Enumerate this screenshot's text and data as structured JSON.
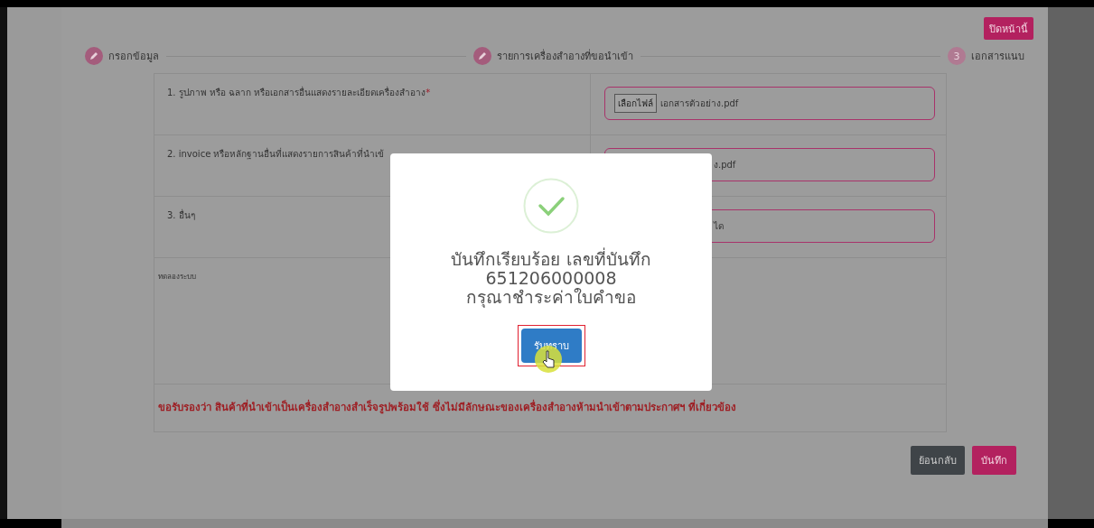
{
  "close_button": "ปิดหน้านี้",
  "steps": [
    {
      "label": "กรอกข้อมูล",
      "kind": "done"
    },
    {
      "label": "รายการเครื่องสำอางที่ขอนำเข้า",
      "kind": "done"
    },
    {
      "label": "เอกสารแนบ",
      "kind": "current",
      "number": "3"
    }
  ],
  "attachments": [
    {
      "label": "1. รูปภาพ หรือ ฉลาก หรือเอกสารอื่นแสดงรายละเอียดเครื่องสำอาง",
      "required_mark": "*",
      "choose_button": "เลือกไฟล์",
      "file": "เอกสารตัวอย่าง.pdf"
    },
    {
      "label": "2. invoice หรือหลักฐานอื่นที่แสดงรายการสินค้าที่นำเข้",
      "file": "ง.pdf"
    },
    {
      "label": "3. อื่นๆ",
      "file": "ได"
    }
  ],
  "remarks": {
    "value": "ทดลองระบบ"
  },
  "declaration": "ขอรับรองว่า สินค้าที่นำเข้าเป็นเครื่องสำอางสำเร็จรูปพร้อมใช้ ซึ่งไม่มีลักษณะของเครื่องสำอางห้ามนำเข้าตามประกาศฯ ที่เกี่ยวข้อง",
  "buttons": [
    "ย้อนกลับ",
    "บันทึก"
  ],
  "dialog": {
    "lines": [
      "บันทึกเรียบร้อย เลขที่บันทึก",
      "651206000008",
      "กรุณาชำระค่าใบคำขอ"
    ],
    "button": "รับทราบ"
  }
}
